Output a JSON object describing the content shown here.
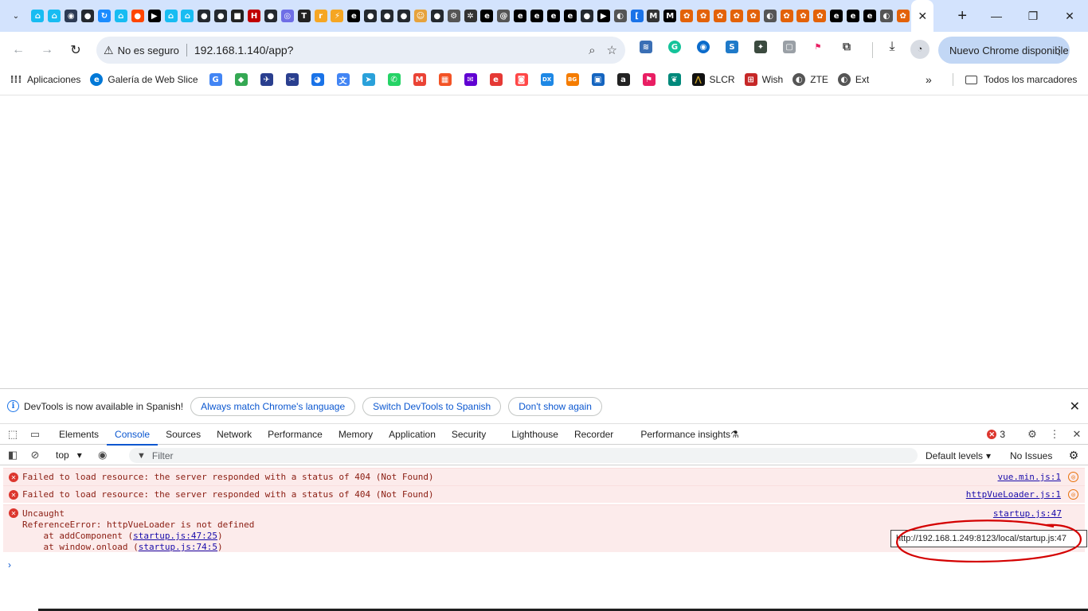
{
  "colors": {
    "tabstrip": "#d3e3fd",
    "accent": "#0b57d0",
    "error": "#dc362e",
    "error_bg": "#fcebeb",
    "annotation": "#d40000"
  },
  "tabs": {
    "pinned": [
      {
        "icon": "home-assistant-icon",
        "color": "#18bcf2",
        "glyph": "⌂"
      },
      {
        "icon": "home-assistant-icon",
        "color": "#18bcf2",
        "glyph": "⌂"
      },
      {
        "icon": "site-icon",
        "color": "#2d3b55",
        "glyph": "◉"
      },
      {
        "icon": "github-icon",
        "color": "#24292f",
        "glyph": "●"
      },
      {
        "icon": "sync-icon",
        "color": "#1a8cff",
        "glyph": "↻"
      },
      {
        "icon": "home-assistant-icon",
        "color": "#18bcf2",
        "glyph": "⌂"
      },
      {
        "icon": "reddit-icon",
        "color": "#ff4500",
        "glyph": "●"
      },
      {
        "icon": "media-icon",
        "color": "#000000",
        "glyph": "▶"
      },
      {
        "icon": "home-assistant-icon",
        "color": "#18bcf2",
        "glyph": "⌂"
      },
      {
        "icon": "home-assistant-icon",
        "color": "#18bcf2",
        "glyph": "⌂"
      },
      {
        "icon": "github-icon",
        "color": "#24292f",
        "glyph": "●"
      },
      {
        "icon": "github-icon",
        "color": "#24292f",
        "glyph": "●"
      },
      {
        "icon": "black-square-icon",
        "color": "#222222",
        "glyph": "■"
      },
      {
        "icon": "h-icon",
        "color": "#c00000",
        "glyph": "H"
      },
      {
        "icon": "github-icon",
        "color": "#24292f",
        "glyph": "●"
      },
      {
        "icon": "circle-icon",
        "color": "#6e6ee6",
        "glyph": "◎"
      },
      {
        "icon": "terminal-icon",
        "color": "#222222",
        "glyph": "T"
      },
      {
        "icon": "r-icon",
        "color": "#f5a623",
        "glyph": "r"
      },
      {
        "icon": "bolt-icon",
        "color": "#f5a623",
        "glyph": "⚡"
      },
      {
        "icon": "e-icon",
        "color": "#000000",
        "glyph": "e"
      },
      {
        "icon": "github-icon",
        "color": "#24292f",
        "glyph": "●"
      },
      {
        "icon": "github-icon",
        "color": "#24292f",
        "glyph": "●"
      },
      {
        "icon": "github-icon",
        "color": "#24292f",
        "glyph": "●"
      },
      {
        "icon": "person-icon",
        "color": "#e6a23c",
        "glyph": "☺"
      },
      {
        "icon": "github-icon",
        "color": "#24292f",
        "glyph": "●"
      },
      {
        "icon": "gear-site-icon",
        "color": "#555555",
        "glyph": "⚙"
      },
      {
        "icon": "flower-icon",
        "color": "#333333",
        "glyph": "✲"
      },
      {
        "icon": "e-icon",
        "color": "#000000",
        "glyph": "e"
      },
      {
        "icon": "e-circle-icon",
        "color": "#555555",
        "glyph": "@"
      },
      {
        "icon": "e-icon",
        "color": "#000000",
        "glyph": "e"
      },
      {
        "icon": "e-icon",
        "color": "#000000",
        "glyph": "e"
      },
      {
        "icon": "e-icon",
        "color": "#000000",
        "glyph": "e"
      },
      {
        "icon": "e-icon",
        "color": "#000000",
        "glyph": "e"
      },
      {
        "icon": "github-icon",
        "color": "#24292f",
        "glyph": "●"
      },
      {
        "icon": "media-icon",
        "color": "#000000",
        "glyph": "▶"
      },
      {
        "icon": "circle-arrow-icon",
        "color": "#555555",
        "glyph": "◐"
      },
      {
        "icon": "bracket-icon",
        "color": "#1a73e8",
        "glyph": "["
      },
      {
        "icon": "m-box-icon",
        "color": "#333333",
        "glyph": "M"
      },
      {
        "icon": "m-icon",
        "color": "#000000",
        "glyph": "M"
      },
      {
        "icon": "flower-orange-icon",
        "color": "#e36209",
        "glyph": "✿"
      },
      {
        "icon": "flower-orange-icon",
        "color": "#e36209",
        "glyph": "✿"
      },
      {
        "icon": "flower-orange-icon",
        "color": "#e36209",
        "glyph": "✿"
      },
      {
        "icon": "flower-orange-icon",
        "color": "#e36209",
        "glyph": "✿"
      },
      {
        "icon": "flower-orange-icon",
        "color": "#e36209",
        "glyph": "✿"
      },
      {
        "icon": "circle-arrow-icon",
        "color": "#555555",
        "glyph": "◐"
      },
      {
        "icon": "flower-orange-icon",
        "color": "#e36209",
        "glyph": "✿"
      },
      {
        "icon": "flower-orange-icon",
        "color": "#e36209",
        "glyph": "✿"
      },
      {
        "icon": "flower-orange-icon",
        "color": "#e36209",
        "glyph": "✿"
      },
      {
        "icon": "e-icon",
        "color": "#000000",
        "glyph": "e"
      },
      {
        "icon": "e-icon",
        "color": "#000000",
        "glyph": "e"
      },
      {
        "icon": "e-icon",
        "color": "#000000",
        "glyph": "e"
      },
      {
        "icon": "circle-arrow-icon",
        "color": "#555555",
        "glyph": "◐"
      },
      {
        "icon": "flower-orange-icon",
        "color": "#e36209",
        "glyph": "✿"
      }
    ]
  },
  "window": {
    "minimize": "—",
    "restore": "❐",
    "close": "✕"
  },
  "toolbar": {
    "not_secure": "No es seguro",
    "url": "192.168.1.140/app?",
    "update_label": "Nuevo Chrome disponible"
  },
  "bookmarks": {
    "apps": "Aplicaciones",
    "webslice": "Galería de Web Slice",
    "slcr": "SLCR",
    "wish": "Wish",
    "zte": "ZTE",
    "ext": "Ext",
    "all": "Todos los marcadores",
    "icons": [
      {
        "icon": "google-icon",
        "color": "#4285f4",
        "glyph": "G"
      },
      {
        "icon": "maps-icon",
        "color": "#34a853",
        "glyph": "◆"
      },
      {
        "icon": "bird-icon",
        "color": "#2a3f8f",
        "glyph": "✈"
      },
      {
        "icon": "tool-icon",
        "color": "#2a3f8f",
        "glyph": "✂"
      },
      {
        "icon": "edge-icon",
        "color": "#1a73e8",
        "glyph": "◕"
      },
      {
        "icon": "translate-icon",
        "color": "#4285f4",
        "glyph": "文"
      },
      {
        "icon": "telegram-icon",
        "color": "#2aa1da",
        "glyph": "➤"
      },
      {
        "icon": "whatsapp-icon",
        "color": "#25d366",
        "glyph": "✆"
      },
      {
        "icon": "gmail-icon",
        "color": "#ea4335",
        "glyph": "M"
      },
      {
        "icon": "microsoft-icon",
        "color": "#f35325",
        "glyph": "▦"
      },
      {
        "icon": "mail-icon",
        "color": "#6001d2",
        "glyph": "✉"
      },
      {
        "icon": "e-red-icon",
        "color": "#e53935",
        "glyph": "e"
      },
      {
        "icon": "aliexpress-icon",
        "color": "#ff4747",
        "glyph": "◙"
      },
      {
        "icon": "dx-icon",
        "color": "#1e88e5",
        "glyph": "DX"
      },
      {
        "icon": "bg-icon",
        "color": "#f57c00",
        "glyph": "BG"
      },
      {
        "icon": "bag-icon",
        "color": "#1565c0",
        "glyph": "▣"
      },
      {
        "icon": "amazon-icon",
        "color": "#222222",
        "glyph": "a"
      },
      {
        "icon": "flag-pink-icon",
        "color": "#e91e63",
        "glyph": "⚑"
      },
      {
        "icon": "leaf-icon",
        "color": "#00897b",
        "glyph": "❦"
      }
    ]
  },
  "devtools": {
    "info_text": "DevTools is now available in Spanish!",
    "btn_match": "Always match Chrome's language",
    "btn_switch": "Switch DevTools to Spanish",
    "btn_dont": "Don't show again",
    "tabs": [
      "Elements",
      "Console",
      "Sources",
      "Network",
      "Performance",
      "Memory",
      "Application",
      "Security",
      "Lighthouse",
      "Recorder",
      "Performance insights"
    ],
    "error_count": "3",
    "context": "top",
    "filter_placeholder": "Filter",
    "levels": "Default levels",
    "issues": "No Issues",
    "messages": [
      {
        "text": "Failed to load resource: the server responded with a status of 404 (Not Found)",
        "source": "vue.min.js:1"
      },
      {
        "text": "Failed to load resource: the server responded with a status of 404 (Not Found)",
        "source": "httpVueLoader.js:1"
      }
    ],
    "uncaught": {
      "line1": "Uncaught",
      "line2": "ReferenceError: httpVueLoader is not defined",
      "line3_prefix": "    at addComponent (",
      "line3_link": "startup.js:47:25",
      "line3_suffix": ")",
      "line4_prefix": "    at window.onload (",
      "line4_link": "startup.js:74:5",
      "line4_suffix": ")",
      "source": "startup.js:47"
    },
    "tooltip": "http://192.168.1.249:8123/local/startup.js:47"
  }
}
